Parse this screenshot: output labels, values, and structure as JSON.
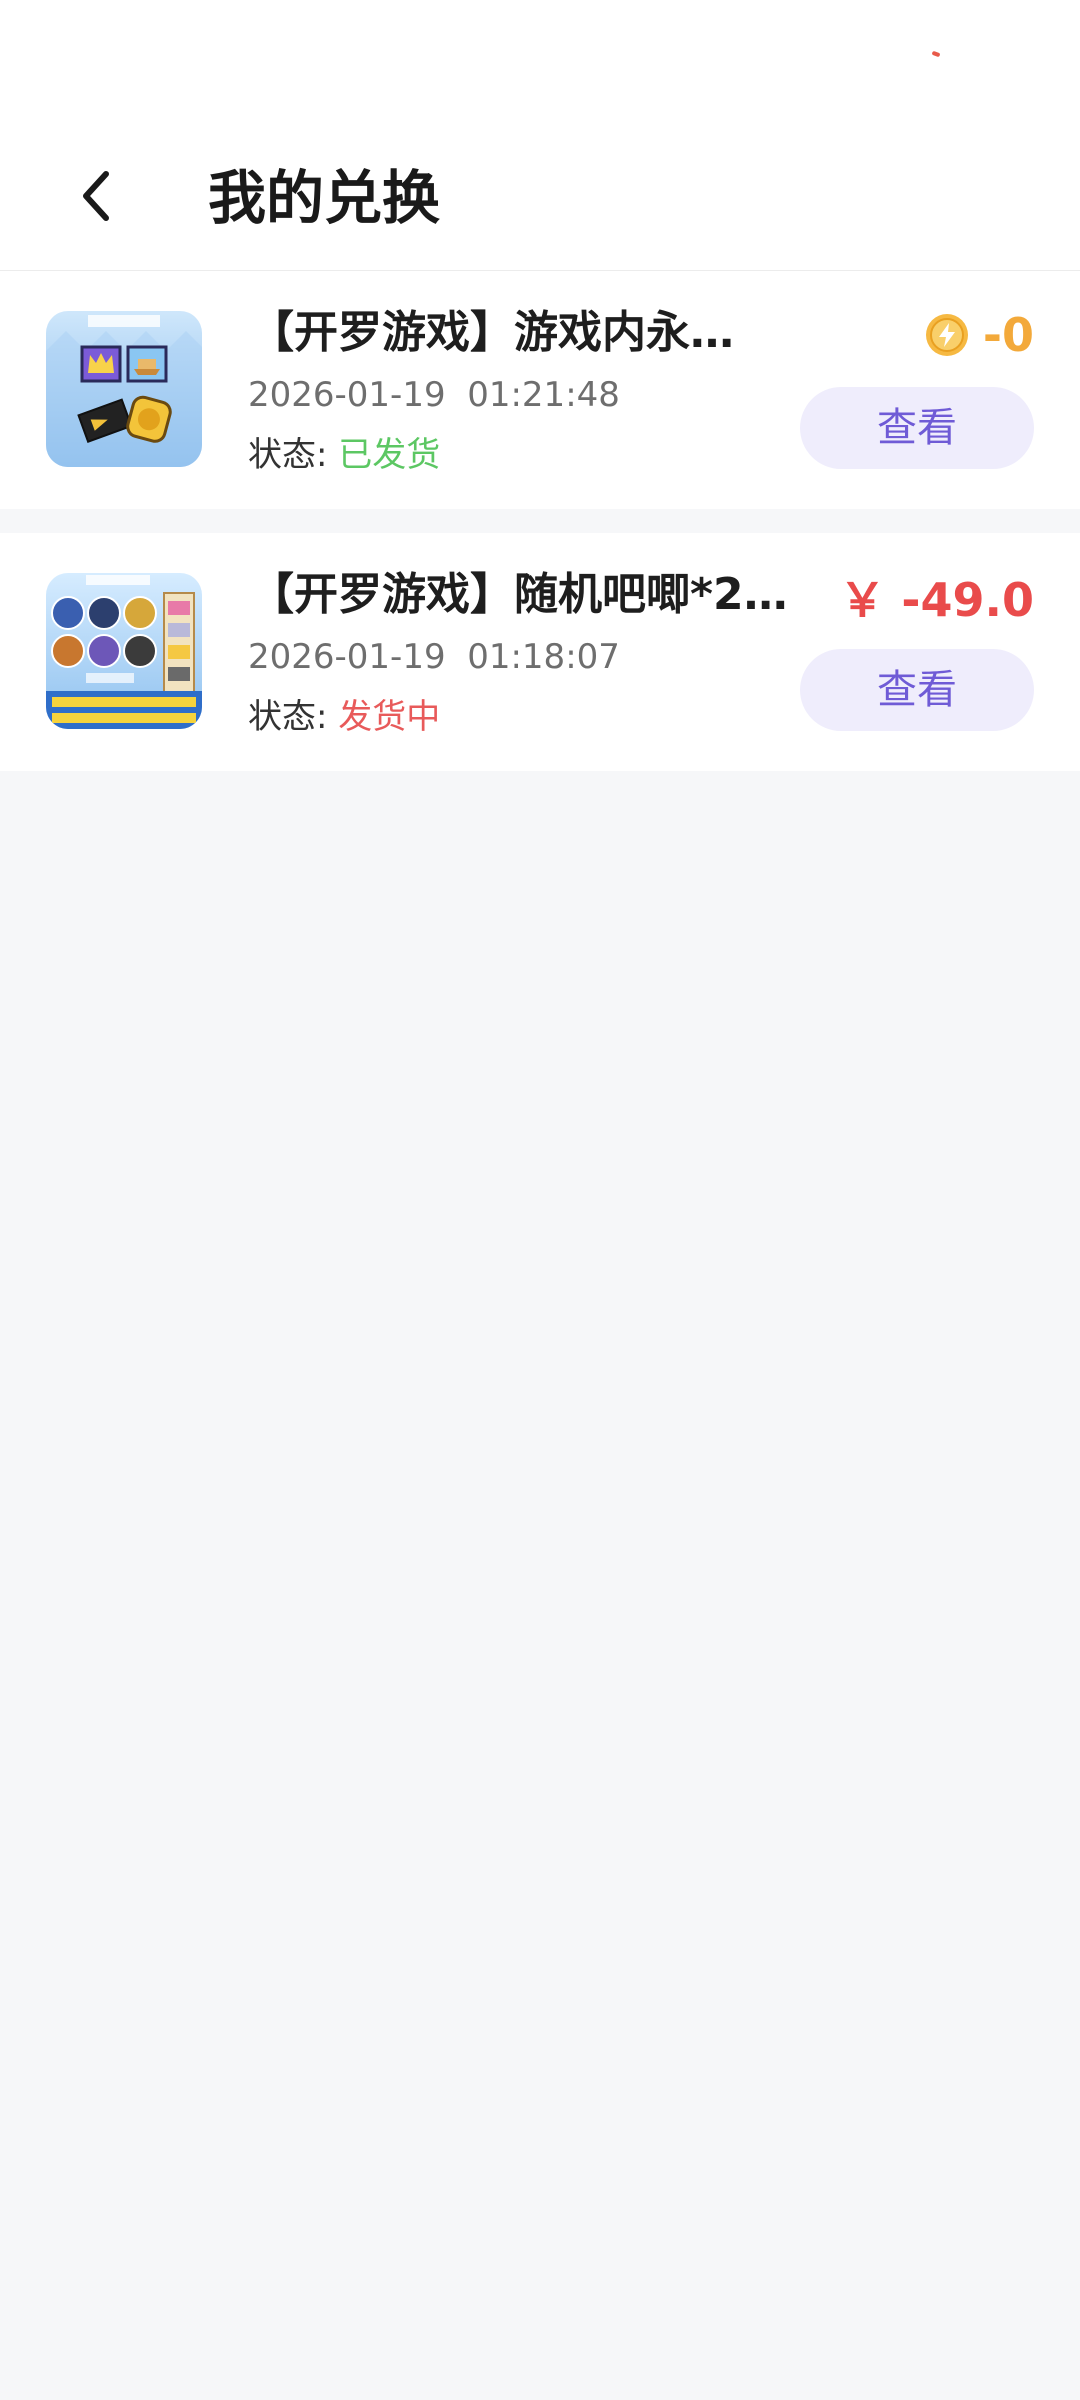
{
  "header": {
    "title": "我的兑换"
  },
  "orders": [
    {
      "title": "【开罗游戏】游戏内永…",
      "time": "2026-01-19  01:21:48",
      "status_label": "状态:",
      "status": "已发货",
      "price": "-0",
      "price_type": "coin",
      "view_label": "查看"
    },
    {
      "title": "【开罗游戏】随机吧唧*2…",
      "time": "2026-01-19  01:18:07",
      "status_label": "状态:",
      "status": "发货中",
      "price": "￥ -49.0",
      "price_type": "cash",
      "view_label": "查看"
    }
  ],
  "colors": {
    "status_shipped": "#5cc763",
    "status_shipping": "#e85a5a",
    "coin_price": "#f3a93a",
    "cash_price": "#e94b4b",
    "button_text": "#6f5bd6",
    "button_bg": "#efedfc"
  },
  "icons": {
    "back": "chevron-left-icon",
    "coin": "lightning-coin-icon"
  }
}
